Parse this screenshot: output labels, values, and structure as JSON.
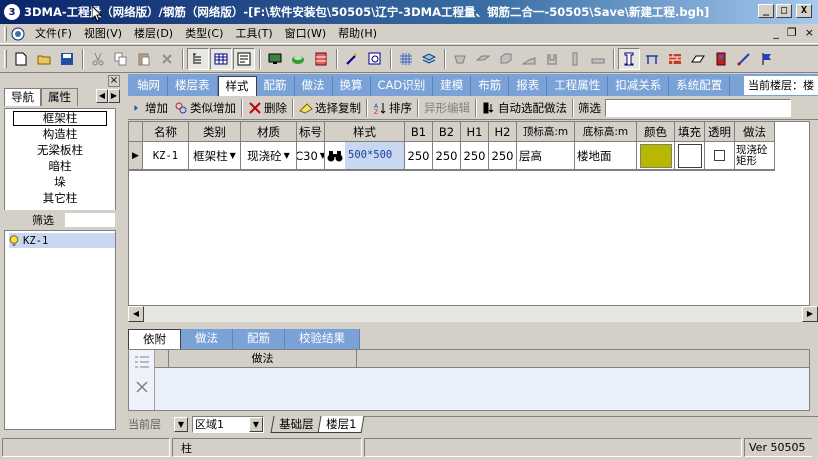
{
  "window": {
    "title": "3DMA-工程量（网络版）/钢筋（网络版）-[F:\\软件安装包\\50505\\辽宁-3DMA工程量、钢筋二合一-50505\\Save\\新建工程.bgh]",
    "minimize": "_",
    "maximize": "□",
    "close": "X",
    "mdi_min": "_",
    "mdi_restore": "❐",
    "mdi_close": "×"
  },
  "menu": [
    "文件(F)",
    "视图(V)",
    "楼层(D)",
    "类型(C)",
    "工具(T)",
    "窗口(W)",
    "帮助(H)"
  ],
  "left_panel": {
    "close": "×",
    "tabs": [
      "导航",
      "属性"
    ],
    "categories": [
      "框架柱",
      "构造柱",
      "无梁板柱",
      "暗柱",
      "垛",
      "其它柱"
    ],
    "filter_label": "筛选",
    "tree_item": "KZ-1"
  },
  "main_tabs": [
    "轴网",
    "楼层表",
    "样式",
    "配筋",
    "做法",
    "换算",
    "CAD识别",
    "建模",
    "布筋",
    "报表",
    "工程属性",
    "扣减关系",
    "系统配置"
  ],
  "current_floor_label": "当前楼层：楼",
  "sub_toolbar": {
    "add": "增加",
    "similar_add": "类似增加",
    "delete": "删除",
    "select_copy": "选择复制",
    "sort": "排序",
    "shape_edit": "异形编辑",
    "auto_match": "自动选配做法",
    "filter": "筛选"
  },
  "grid": {
    "headers": [
      "名称",
      "类别",
      "材质",
      "标号",
      "样式",
      "B1",
      "B2",
      "H1",
      "H2",
      "顶标高:m",
      "底标高:m",
      "颜色",
      "填充",
      "透明",
      "做法"
    ],
    "row": {
      "name": "KZ-1",
      "category": "框架柱",
      "material": "现浇砼",
      "grade": "C30",
      "style": "500*500",
      "b1": "250",
      "b2": "250",
      "h1": "250",
      "h2": "250",
      "top": "层高",
      "bottom": "楼地面",
      "color": "#b8b800",
      "method": "现浇砼矩形"
    }
  },
  "bottom_tabs": [
    "依附",
    "做法",
    "配筋",
    "校验结果"
  ],
  "bottom_grid_header": "做法",
  "bottom_bar": {
    "current_layer": "当前层",
    "region": "区域1",
    "floor_tabs": [
      "基础层",
      "楼层1"
    ]
  },
  "status": {
    "middle": "柱",
    "version": "Ver 50505"
  }
}
